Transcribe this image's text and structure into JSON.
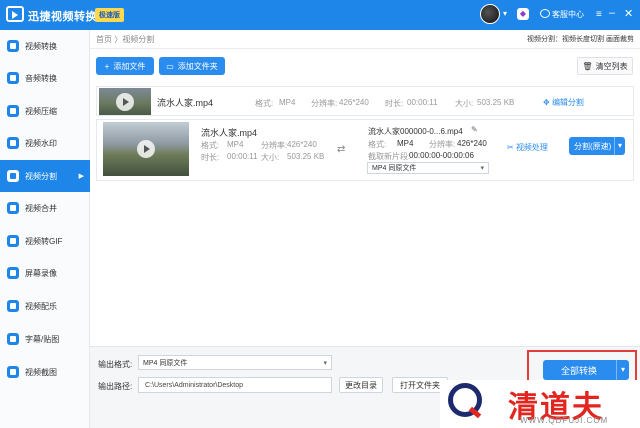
{
  "app": {
    "title": "迅捷视频转换器",
    "edition_badge": "极速版"
  },
  "titlebar": {
    "dropdown_arrow": "▾",
    "vip_glyph": "◆",
    "service_label": "客服中心",
    "menu_glyph": "≡",
    "min_glyph": "–",
    "close_glyph": "✕"
  },
  "sidebar": {
    "items": [
      {
        "label": "视频转换",
        "icon": "video-convert-icon"
      },
      {
        "label": "音频转换",
        "icon": "audio-convert-icon"
      },
      {
        "label": "视频压缩",
        "icon": "video-compress-icon"
      },
      {
        "label": "视频水印",
        "icon": "watermark-icon"
      },
      {
        "label": "视频分割",
        "icon": "split-icon",
        "active": true
      },
      {
        "label": "视频合并",
        "icon": "merge-icon"
      },
      {
        "label": "视频转GIF",
        "icon": "gif-icon"
      },
      {
        "label": "屏幕录像",
        "icon": "screen-record-icon"
      },
      {
        "label": "视频配乐",
        "icon": "music-icon"
      },
      {
        "label": "字幕/贴图",
        "icon": "subtitle-icon"
      },
      {
        "label": "视频截图",
        "icon": "screenshot-icon"
      }
    ]
  },
  "breadcrumb": "首页 〉视频分割",
  "hint": "视频分割：视频长度切割 画面裁剪",
  "toolbar": {
    "add_file": "添加文件",
    "add_folder": "添加文件夹",
    "clear_list": "清空列表"
  },
  "row1": {
    "filename": "流水人家.mp4",
    "format_label": "格式:",
    "format_value": "MP4",
    "resolution_label": "分辨率:",
    "resolution_value": "426*240",
    "duration_label": "时长:",
    "duration_value": "00:00:11",
    "size_label": "大小:",
    "size_value": "503.25 KB",
    "edit_label": "编辑分割"
  },
  "row2": {
    "filename": "流水人家.mp4",
    "format_label": "格式:",
    "format_value": "MP4",
    "resolution_label": "分辨率:",
    "resolution_value": "426*240",
    "duration_label": "时长:",
    "duration_value": "00:00:11",
    "size_label": "大小:",
    "size_value": "503.25 KB",
    "output_name": "流水人家000000-0...6.mp4",
    "out_format_label": "格式:",
    "out_format_value": "MP4",
    "out_resolution_label": "分辨率:",
    "out_resolution_value": "426*240",
    "clip_label": "截取新片段:",
    "clip_value": "00:00:00-00:00:06",
    "format_select": "MP4  同原文件",
    "process_label": "视频处理",
    "split_button": "分割(原速)"
  },
  "bottom": {
    "output_format_label": "输出格式:",
    "output_format_value": "MP4  同原文件",
    "output_path_label": "输出路径:",
    "output_path_value": "C:\\Users\\Administrator\\Desktop",
    "change_dir": "更改目录",
    "open_folder": "打开文件夹",
    "convert_all": "全部转换"
  },
  "watermark": {
    "text": "清道夫",
    "url": "WWW.QDFUJI.COM"
  },
  "colors": {
    "primary": "#1d86e8",
    "button": "#2b8cf0",
    "highlight_frame": "#e43b3b",
    "watermark_red": "#e2261f"
  }
}
